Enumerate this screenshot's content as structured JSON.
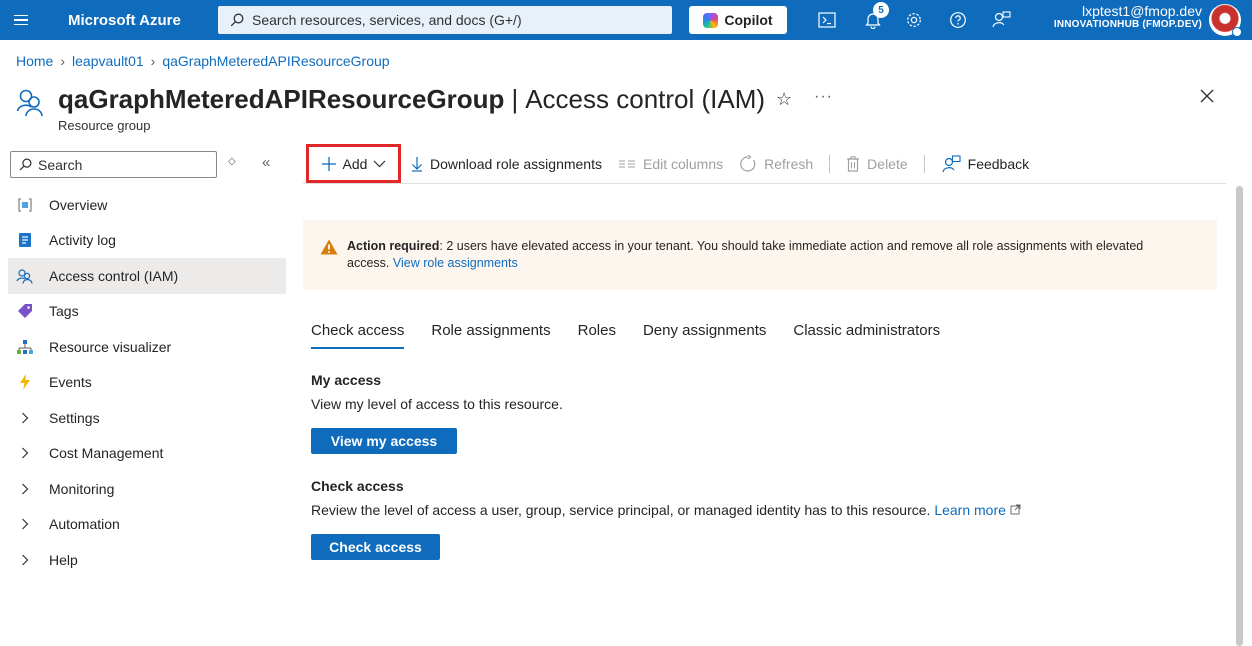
{
  "topbar": {
    "brand": "Microsoft Azure",
    "search_placeholder": "Search resources, services, and docs (G+/)",
    "copilot_label": "Copilot",
    "notification_count": "5",
    "account_email": "lxptest1@fmop.dev",
    "account_tenant": "INNOVATIONHUB (FMOP.DEV)"
  },
  "breadcrumb": {
    "items": [
      "Home",
      "leapvault01",
      "qaGraphMeteredAPIResourceGroup"
    ]
  },
  "header": {
    "resource_name": "qaGraphMeteredAPIResourceGroup",
    "separator": "|",
    "blade_title": "Access control (IAM)",
    "subtitle": "Resource group",
    "more": "···"
  },
  "nav": {
    "search_placeholder": "Search",
    "items": [
      {
        "label": "Overview",
        "icon": "resource-group-icon"
      },
      {
        "label": "Activity log",
        "icon": "activity-log-icon"
      },
      {
        "label": "Access control (IAM)",
        "icon": "iam-icon",
        "active": true
      },
      {
        "label": "Tags",
        "icon": "tag-icon"
      },
      {
        "label": "Resource visualizer",
        "icon": "visualizer-icon"
      },
      {
        "label": "Events",
        "icon": "lightning-icon"
      },
      {
        "label": "Settings",
        "icon": "chevron-right-icon"
      },
      {
        "label": "Cost Management",
        "icon": "chevron-right-icon"
      },
      {
        "label": "Monitoring",
        "icon": "chevron-right-icon"
      },
      {
        "label": "Automation",
        "icon": "chevron-right-icon"
      },
      {
        "label": "Help",
        "icon": "chevron-right-icon"
      }
    ]
  },
  "toolbar": {
    "add": "Add",
    "download": "Download role assignments",
    "edit_columns": "Edit columns",
    "refresh": "Refresh",
    "delete": "Delete",
    "feedback": "Feedback"
  },
  "alert": {
    "bold": "Action required",
    "text": ": 2 users have elevated access in your tenant. You should take immediate action and remove all role assignments with elevated access.",
    "link": "View role assignments"
  },
  "tabs": [
    "Check access",
    "Role assignments",
    "Roles",
    "Deny assignments",
    "Classic administrators"
  ],
  "my_access": {
    "title": "My access",
    "description": "View my level of access to this resource.",
    "button": "View my access"
  },
  "check_access": {
    "title": "Check access",
    "description": "Review the level of access a user, group, service principal, or managed identity has to this resource.",
    "link": "Learn more",
    "button": "Check access"
  },
  "colors": {
    "topbar": "#0f6cbd",
    "accent": "#0f6cbd",
    "highlight_border": "#e12727",
    "alert_bg": "#fdf6ee",
    "warning": "#d67f0e"
  }
}
